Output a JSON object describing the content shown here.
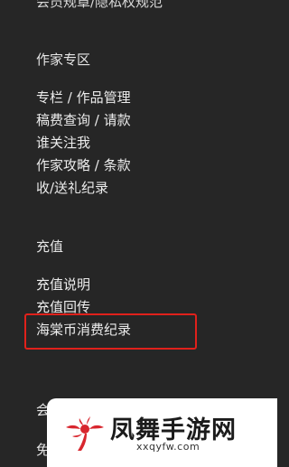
{
  "top_cutoff_text": "会员规章/隐私权规范",
  "sections": {
    "writer": {
      "title": "作家专区",
      "items": [
        "专栏 / 作品管理",
        "稿费查询 / 请款",
        "谁关注我",
        "作家攻略 / 条款",
        "收/送礼纪录"
      ]
    },
    "recharge": {
      "title": "充值",
      "items": [
        "充值说明",
        "充值回传",
        "海棠币消费纪录"
      ]
    }
  },
  "peek_text": [
    "会",
    "免"
  ],
  "highlight": {
    "item": "海棠币消费纪录",
    "color": "#e0211b"
  },
  "watermark": {
    "name": "凤舞手游网",
    "url": "xxqyfw.com",
    "logo_icon": "phoenix-logo-icon"
  },
  "colors": {
    "background": "#262626",
    "text": "#ececec",
    "highlight_border": "#e0211b"
  }
}
